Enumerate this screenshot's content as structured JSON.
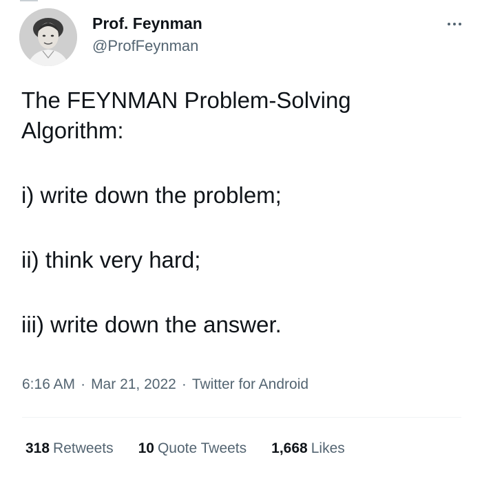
{
  "author": {
    "display_name": "Prof. Feynman",
    "handle": "@ProfFeynman",
    "avatar_icon": "profile-photo"
  },
  "more_icon": "more-options-icon",
  "tweet": {
    "lines": [
      "The FEYNMAN Problem-Solving",
      "Algorithm:",
      "i) write down the problem;",
      "ii) think very hard;",
      "iii) write down the answer."
    ]
  },
  "meta": {
    "time": "6:16 AM",
    "separator": "·",
    "date": "Mar 21, 2022",
    "source": "Twitter for Android"
  },
  "stats": {
    "retweets": {
      "count": "318",
      "label": "Retweets"
    },
    "quotes": {
      "count": "10",
      "label": "Quote Tweets"
    },
    "likes": {
      "count": "1,668",
      "label": "Likes"
    }
  },
  "colors": {
    "text_primary": "#0f1419",
    "text_secondary": "#536471",
    "divider": "#eff3f4"
  }
}
